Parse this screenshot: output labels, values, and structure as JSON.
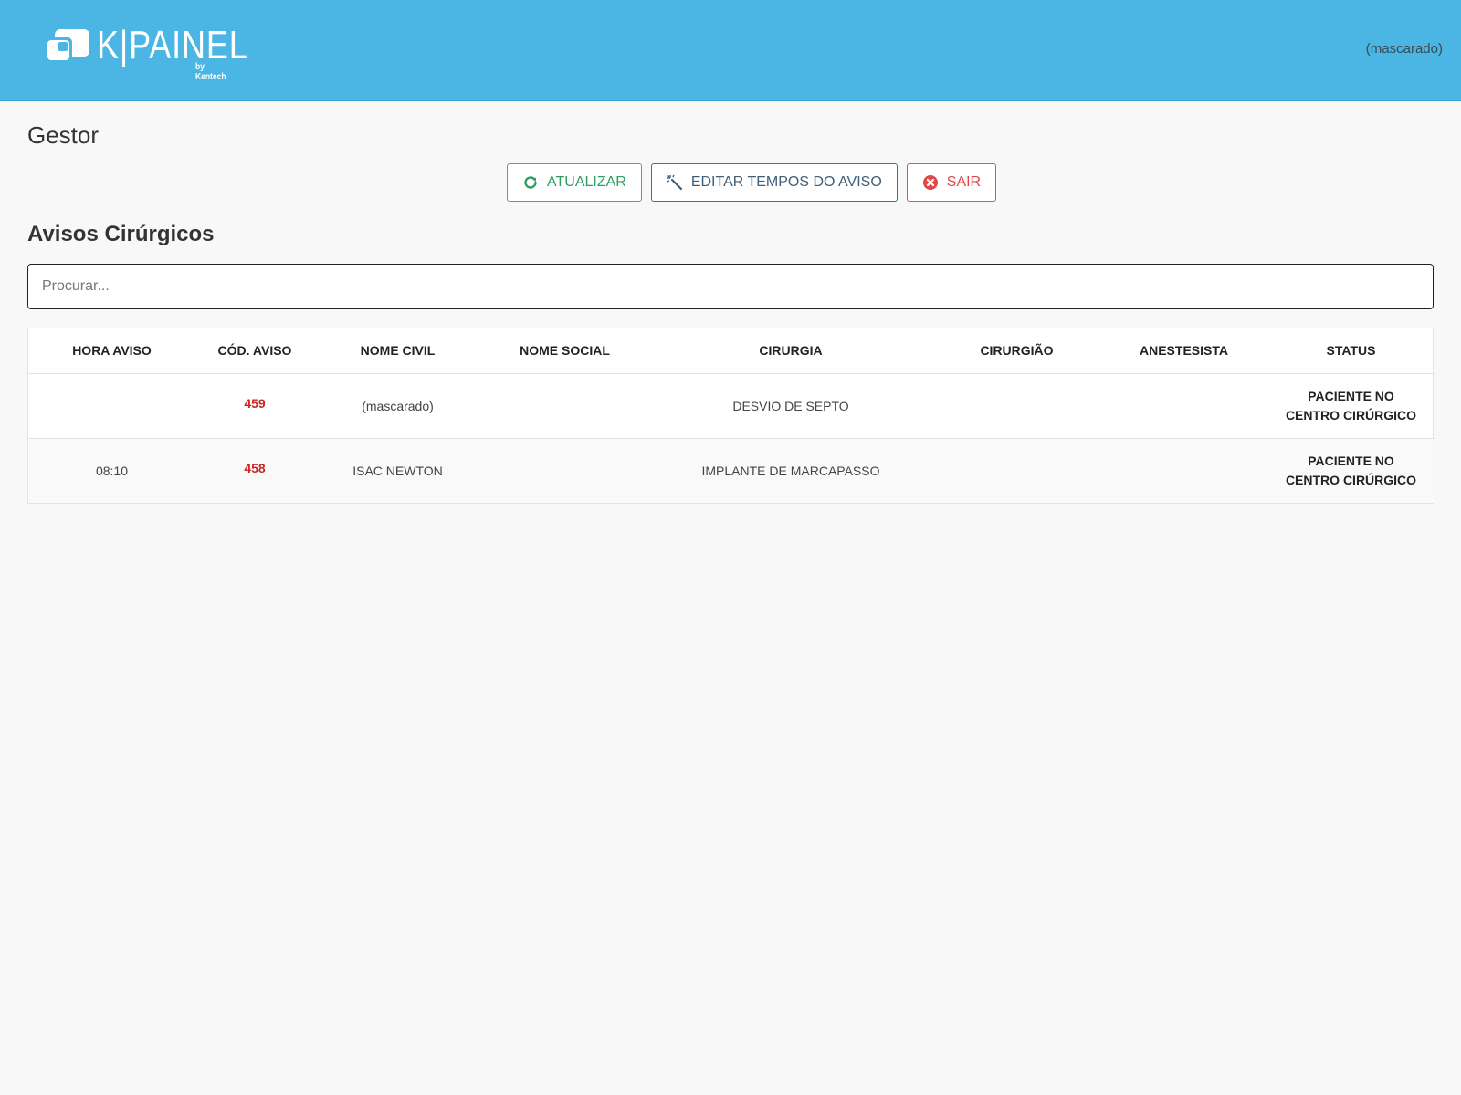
{
  "header": {
    "logo_text": "K|PAINEL",
    "logo_sub": "by Kentech",
    "user": "(mascarado)"
  },
  "page": {
    "title": "Gestor",
    "section_title": "Avisos Cirúrgicos"
  },
  "actions": {
    "refresh_label": "ATUALIZAR",
    "edit_times_label": "EDITAR TEMPOS DO AVISO",
    "exit_label": "SAIR"
  },
  "search": {
    "placeholder": "Procurar...",
    "value": ""
  },
  "table": {
    "columns": [
      "HORA AVISO",
      "CÓD. AVISO",
      "NOME CIVIL",
      "NOME SOCIAL",
      "CIRURGIA",
      "CIRURGIÃO",
      "ANESTESISTA",
      "STATUS"
    ],
    "rows": [
      {
        "hora": "",
        "codigo": "459",
        "nome_civil": "(mascarado)",
        "nome_social": "",
        "cirurgia": "DESVIO DE SEPTO",
        "cirurgiao": "",
        "anestesista": "",
        "status": "PACIENTE NO CENTRO CIRÚRGICO"
      },
      {
        "hora": "08:10",
        "codigo": "458",
        "nome_civil": "ISAC NEWTON",
        "nome_social": "",
        "cirurgia": "IMPLANTE DE MARCAPASSO",
        "cirurgiao": "",
        "anestesista": "",
        "status": "PACIENTE NO CENTRO CIRÚRGICO"
      }
    ]
  },
  "colors": {
    "header_bg": "#4bb5e3",
    "refresh": "#2f9e63",
    "edit": "#3f5e78",
    "exit": "#e04848",
    "code": "#c62828"
  },
  "icons": {
    "refresh": "refresh-icon",
    "edit": "magic-wand-icon",
    "exit": "close-circle-icon",
    "logo": "chat-bubbles-icon"
  }
}
